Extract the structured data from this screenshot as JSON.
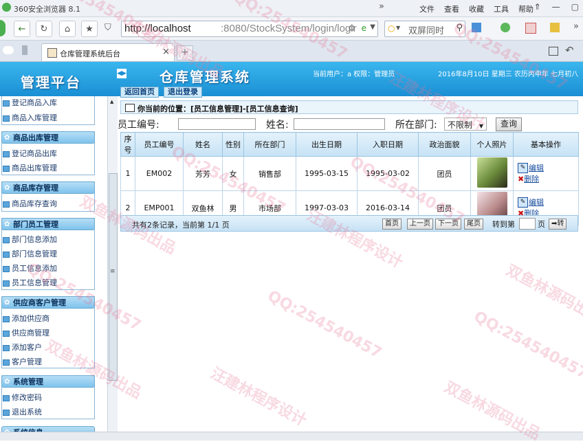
{
  "browser": {
    "title": "360安全浏览器 8.1",
    "menus": [
      "文件",
      "查看",
      "收藏",
      "工具",
      "帮助"
    ],
    "url_host": "http://localhost",
    "url_path": ":8080/StockSystem/login/logir",
    "search_placeholder": "双屏同时",
    "tab_title": "仓库管理系统后台"
  },
  "header": {
    "logo": "管理平台",
    "system_name": "仓库管理系统",
    "user_info": "当前用户：a  权限：管理员",
    "date_info": "2016年8月10日 星期三 农历丙申年 七月初八",
    "home_button": "返回首页",
    "logout_button": "退出登录"
  },
  "sidebar": {
    "groups": [
      {
        "title": "",
        "items": [
          "登记商品入库",
          "商品入库管理"
        ]
      },
      {
        "title": "商品出库管理",
        "items": [
          "登记商品出库",
          "商品出库管理"
        ]
      },
      {
        "title": "商品库存管理",
        "items": [
          "商品库存查询"
        ]
      },
      {
        "title": "部门员工管理",
        "items": [
          "部门信息添加",
          "部门信息管理",
          "员工信息添加",
          "员工信息管理"
        ]
      },
      {
        "title": "供应商客户管理",
        "items": [
          "添加供应商",
          "供应商管理",
          "添加客户",
          "客户管理"
        ]
      },
      {
        "title": "系统管理",
        "items": [
          "修改密码",
          "退出系统"
        ]
      },
      {
        "title": "系统信息",
        "items": []
      }
    ]
  },
  "main": {
    "location": "你当前的位置：[员工信息管理]-[员工信息查询]",
    "filter": {
      "emp_no_label": "员工编号:",
      "name_label": "姓名:",
      "dept_label": "所在部门:",
      "dept_selected": "不限制",
      "query_button": "查询"
    },
    "table": {
      "headers": [
        "序号",
        "员工编号",
        "姓名",
        "性别",
        "所在部门",
        "出生日期",
        "入职日期",
        "政治面貌",
        "个人照片",
        "基本操作"
      ],
      "rows": [
        {
          "no": "1",
          "emp_no": "EM002",
          "name": "芳芳",
          "gender": "女",
          "dept": "销售部",
          "birth": "1995-03-15",
          "hire": "1995-03-02",
          "politics": "团员",
          "edit": "编辑",
          "delete": "删除"
        },
        {
          "no": "2",
          "emp_no": "EMP001",
          "name": "双鱼林",
          "gender": "男",
          "dept": "市场部",
          "birth": "1997-03-03",
          "hire": "2016-03-14",
          "politics": "团员",
          "edit": "编辑",
          "delete": "删除"
        }
      ]
    },
    "pager": {
      "info": "共有2条记录，当前第 1/1 页",
      "first": "首页",
      "prev": "上一页",
      "next": "下一页",
      "last": "尾页",
      "goto_label": "转到第",
      "page_word": "页",
      "go": "➡转"
    }
  },
  "watermarks": [
    "QQ:254540457",
    "汪建林程序设计",
    "双鱼林源码出品"
  ],
  "colors": {
    "header_blue": "#1a8fd4",
    "sidebar_head": "#7fc3ec",
    "watermark": "#e67896"
  }
}
